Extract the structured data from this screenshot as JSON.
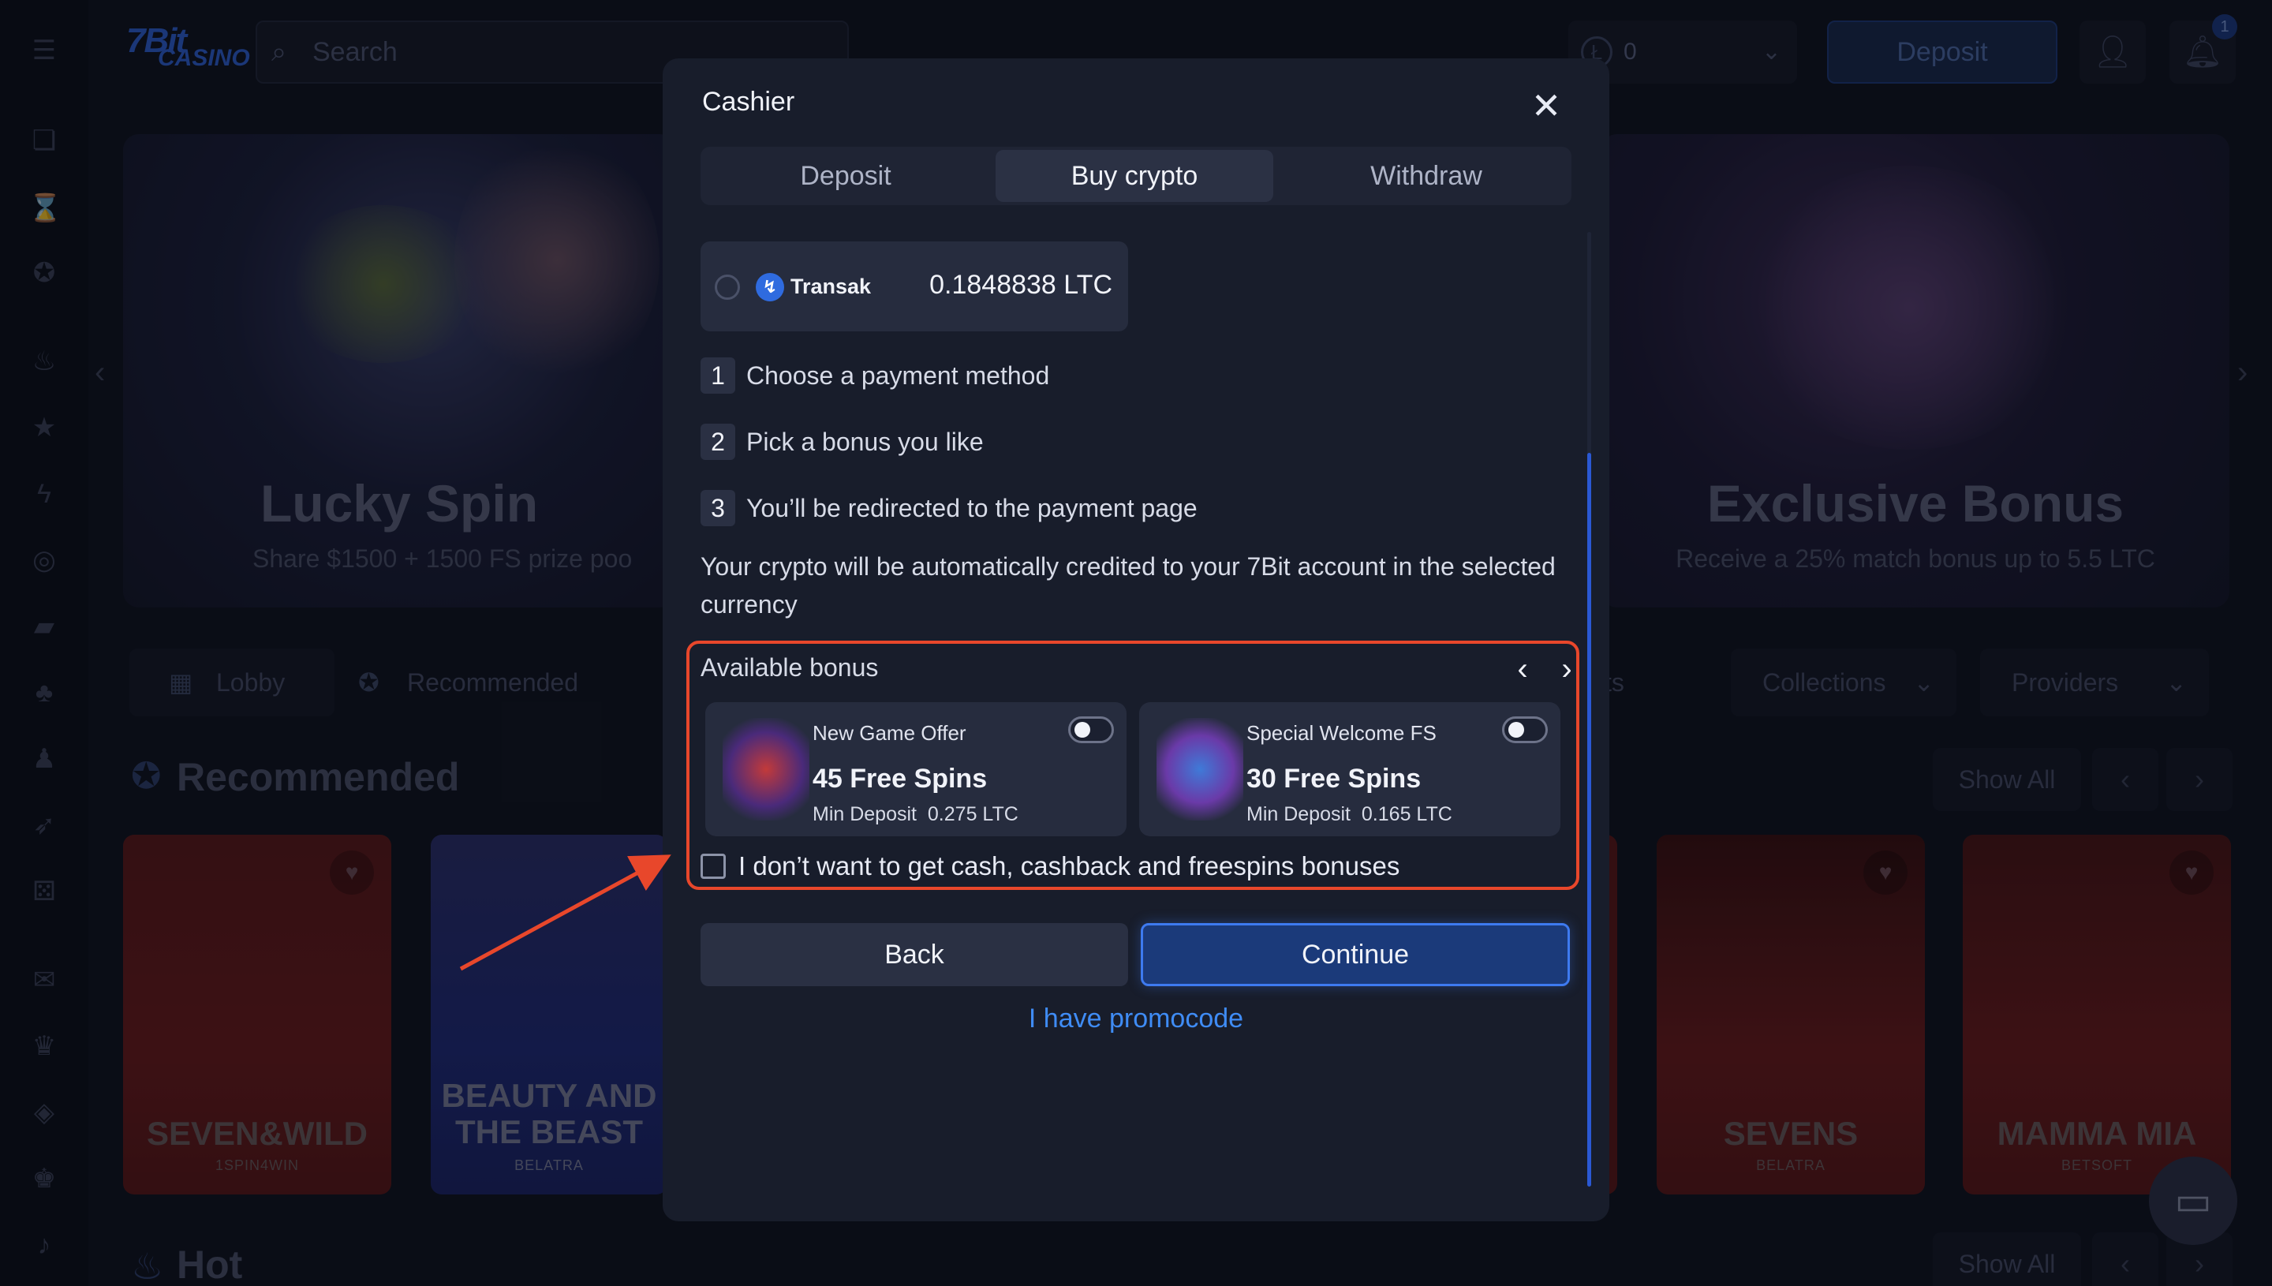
{
  "site": {
    "logo_top": "7Bit",
    "logo_bottom": "CASINO",
    "search_placeholder": "Search",
    "balance": "0",
    "balance_coin": "Ł",
    "deposit_label": "Deposit",
    "notification_count": "1",
    "banners": [
      {
        "title": "Lucky Spin",
        "subtitle": "Share $1500 + 1500 FS prize poo"
      },
      {
        "title": "Exclusive Bonus",
        "subtitle": "Receive a 25% match bonus up to 5.5 LTC"
      }
    ],
    "nav_pills": [
      {
        "label": "Lobby"
      },
      {
        "label": "Recommended"
      }
    ],
    "nav_partial": "ts",
    "dropdowns": [
      {
        "label": "Collections"
      },
      {
        "label": "Providers"
      }
    ],
    "sections": [
      {
        "title": "Recommended",
        "show_all": "Show All"
      },
      {
        "title": "Hot",
        "show_all": "Show All"
      }
    ],
    "games": [
      {
        "title": "SEVEN&WILD",
        "provider": "1SPIN4WIN"
      },
      {
        "title": "BEAUTY AND THE BEAST",
        "provider": "BELATRA"
      },
      {
        "title": "SEVENS",
        "provider": "BELATRA"
      },
      {
        "title": "MAMMA MIA",
        "provider": "BETSOFT"
      }
    ]
  },
  "cashier": {
    "title": "Cashier",
    "tabs": [
      {
        "label": "Deposit",
        "active": false
      },
      {
        "label": "Buy crypto",
        "active": true
      },
      {
        "label": "Withdraw",
        "active": false
      }
    ],
    "provider": {
      "name": "Transak",
      "amount": "0.1848838 LTC"
    },
    "steps": [
      {
        "num": "1",
        "text": "Choose a payment method"
      },
      {
        "num": "2",
        "text": "Pick a bonus you like"
      },
      {
        "num": "3",
        "text": "You’ll be redirected to the payment page"
      }
    ],
    "info": "Your crypto will be automatically credited to your 7Bit account in the selected currency",
    "bonus": {
      "label": "Available bonus",
      "items": [
        {
          "name": "New Game Offer",
          "spins": "45 Free Spins",
          "min_label": "Min Deposit",
          "min_value": "0.275 LTC",
          "enabled": false
        },
        {
          "name": "Special Welcome FS",
          "spins": "30 Free Spins",
          "min_label": "Min Deposit",
          "min_value": "0.165 LTC",
          "enabled": false
        }
      ],
      "opt_out": "I don’t want to get cash, cashback and freespins bonuses",
      "opt_out_checked": false
    },
    "back_label": "Back",
    "continue_label": "Continue",
    "promo_label": "I have promocode"
  },
  "colors": {
    "accent": "#3e7af0",
    "highlight_border": "#e8472b",
    "modal_bg": "#181d2b"
  }
}
